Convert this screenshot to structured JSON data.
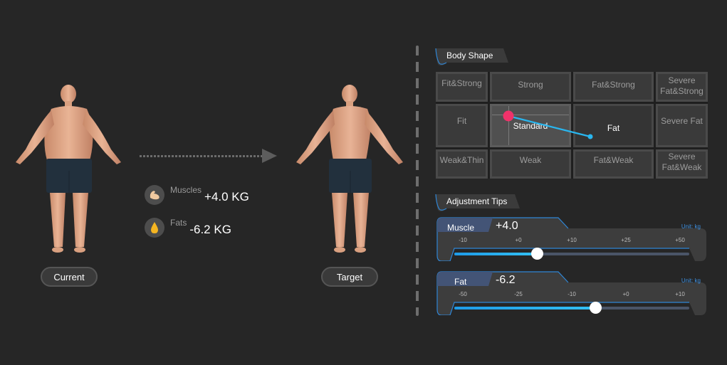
{
  "figures": {
    "current": {
      "label": "Current"
    },
    "target": {
      "label": "Target"
    }
  },
  "changes": {
    "muscle": {
      "label": "Muscles",
      "value": "+4.0 KG",
      "icon": "flexed-arm-icon"
    },
    "fat": {
      "label": "Fats",
      "value": "-6.2 KG",
      "icon": "fat-drop-icon"
    }
  },
  "body_shape": {
    "title": "Body Shape",
    "cells": [
      [
        "Fit&Strong",
        "Strong",
        "Fat&Strong",
        "Severe Fat&Strong"
      ],
      [
        "Fit",
        "Standard",
        "Fat",
        "Severe Fat"
      ],
      [
        "Weak&Thin",
        "Weak",
        "Fat&Weak",
        "Severe Fat&Weak"
      ]
    ],
    "current_shape": "Standard",
    "target_shape": "Fat",
    "colors": {
      "current_marker": "#f0326a",
      "target_marker": "#29b6ef"
    }
  },
  "adjustment": {
    "title": "Adjustment Tips",
    "muscle": {
      "label": "Muscle",
      "value": "+4.0",
      "unit": "Unit: kg",
      "ticks": [
        "-10",
        "+0",
        "+10",
        "+25",
        "+50"
      ],
      "fraction": 0.35
    },
    "fat": {
      "label": "Fat",
      "value": "-6.2",
      "unit": "Unit: kg",
      "ticks": [
        "-50",
        "-25",
        "-10",
        "+0",
        "+10"
      ],
      "fraction": 0.6
    }
  },
  "colors": {
    "accent": "#2f86d6",
    "slider_fill": "#29b6ef",
    "background": "#262626"
  }
}
